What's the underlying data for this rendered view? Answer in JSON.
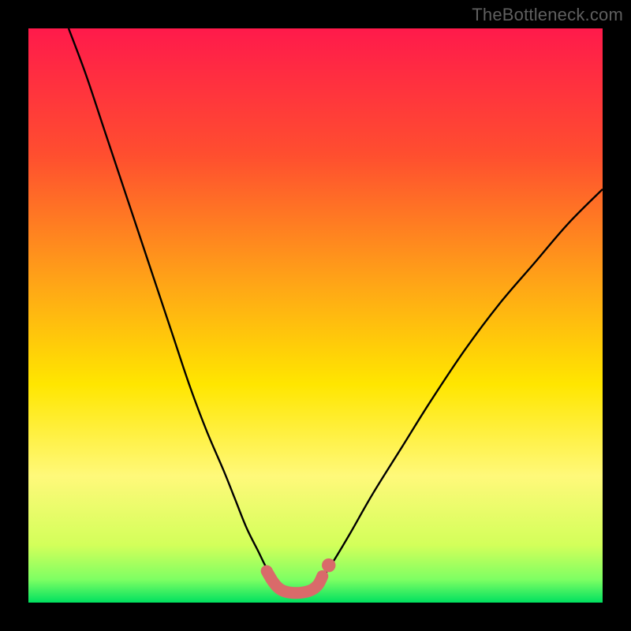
{
  "watermark": "TheBottleneck.com",
  "chart_data": {
    "type": "line",
    "title": "",
    "xlabel": "",
    "ylabel": "",
    "xlim": [
      0,
      100
    ],
    "ylim": [
      0,
      100
    ],
    "grid": false,
    "legend": false,
    "gradient_stops": [
      {
        "offset": 0,
        "color": "#ff1a4b"
      },
      {
        "offset": 0.22,
        "color": "#ff4e2f"
      },
      {
        "offset": 0.45,
        "color": "#ffa716"
      },
      {
        "offset": 0.62,
        "color": "#ffe600"
      },
      {
        "offset": 0.78,
        "color": "#fff97a"
      },
      {
        "offset": 0.9,
        "color": "#d3ff5a"
      },
      {
        "offset": 0.96,
        "color": "#7dff63"
      },
      {
        "offset": 1.0,
        "color": "#00e060"
      }
    ],
    "series": [
      {
        "name": "left-branch",
        "style": "black-thin",
        "x": [
          7,
          10,
          13,
          16,
          19,
          22,
          25,
          28,
          31,
          34,
          36,
          38,
          40,
          41.5,
          43
        ],
        "y": [
          100,
          92,
          83,
          74,
          65,
          56,
          47,
          38,
          30,
          23,
          18,
          13,
          9,
          6,
          4
        ]
      },
      {
        "name": "right-branch",
        "style": "black-thin",
        "x": [
          51,
          53,
          56,
          60,
          65,
          70,
          76,
          82,
          88,
          94,
          100
        ],
        "y": [
          4,
          7,
          12,
          19,
          27,
          35,
          44,
          52,
          59,
          66,
          72
        ]
      },
      {
        "name": "valley-highlight",
        "style": "pink-thick",
        "x": [
          41.5,
          42.5,
          43.5,
          44.5,
          46,
          48,
          49.5,
          50.5,
          51.2
        ],
        "y": [
          5.5,
          3.8,
          2.6,
          2.0,
          1.7,
          1.8,
          2.3,
          3.2,
          4.6
        ]
      }
    ],
    "markers": [
      {
        "name": "dot-right",
        "x": 52.3,
        "y": 6.5,
        "r": 1.2,
        "color": "#d96a6a"
      }
    ]
  }
}
